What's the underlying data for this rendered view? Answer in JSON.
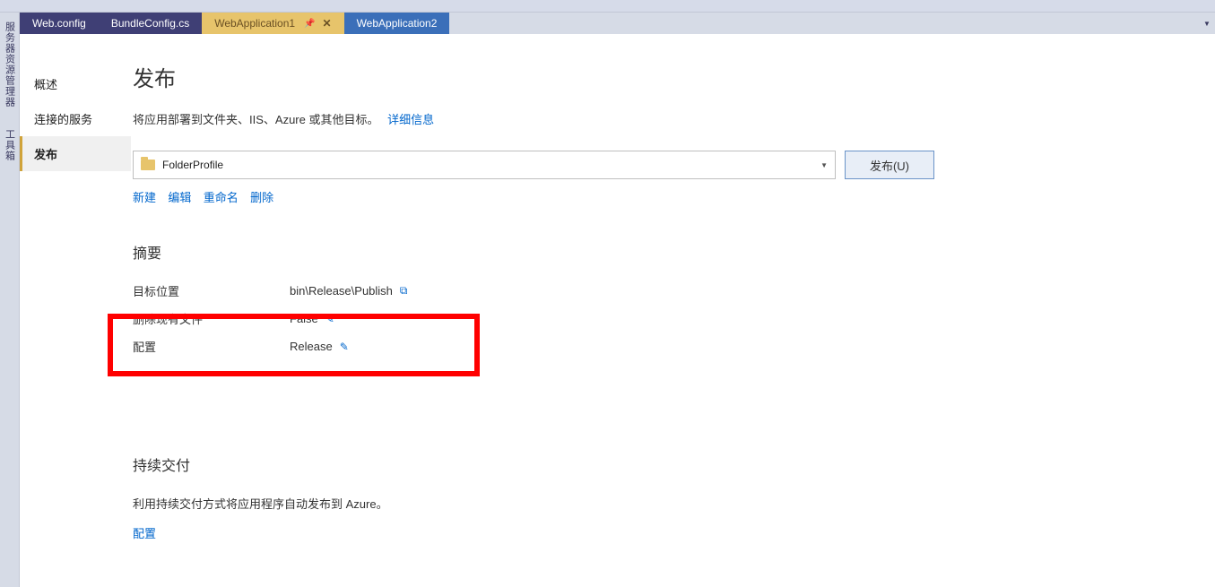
{
  "vertical_tabs": [
    "服务器资源管理器",
    "工具箱"
  ],
  "tabs": [
    {
      "label": "Web.config"
    },
    {
      "label": "BundleConfig.cs"
    },
    {
      "label": "WebApplication1"
    },
    {
      "label": "WebApplication2"
    }
  ],
  "sidebar": {
    "items": [
      "概述",
      "连接的服务",
      "发布"
    ]
  },
  "page": {
    "title": "发布",
    "subtitle": "将应用部署到文件夹、IIS、Azure 或其他目标。",
    "details_link": "详细信息"
  },
  "profile": {
    "selected": "FolderProfile",
    "publish_btn": "发布(U)",
    "actions": [
      "新建",
      "编辑",
      "重命名",
      "删除"
    ]
  },
  "summary": {
    "heading": "摘要",
    "rows": [
      {
        "label": "目标位置",
        "value": "bin\\Release\\Publish",
        "icon": "copy"
      },
      {
        "label": "删除现有文件",
        "value": "False",
        "icon": "pencil"
      },
      {
        "label": "配置",
        "value": "Release",
        "icon": "pencil"
      }
    ]
  },
  "cd": {
    "heading": "持续交付",
    "desc": "利用持续交付方式将应用程序自动发布到 Azure。",
    "config_link": "配置"
  }
}
